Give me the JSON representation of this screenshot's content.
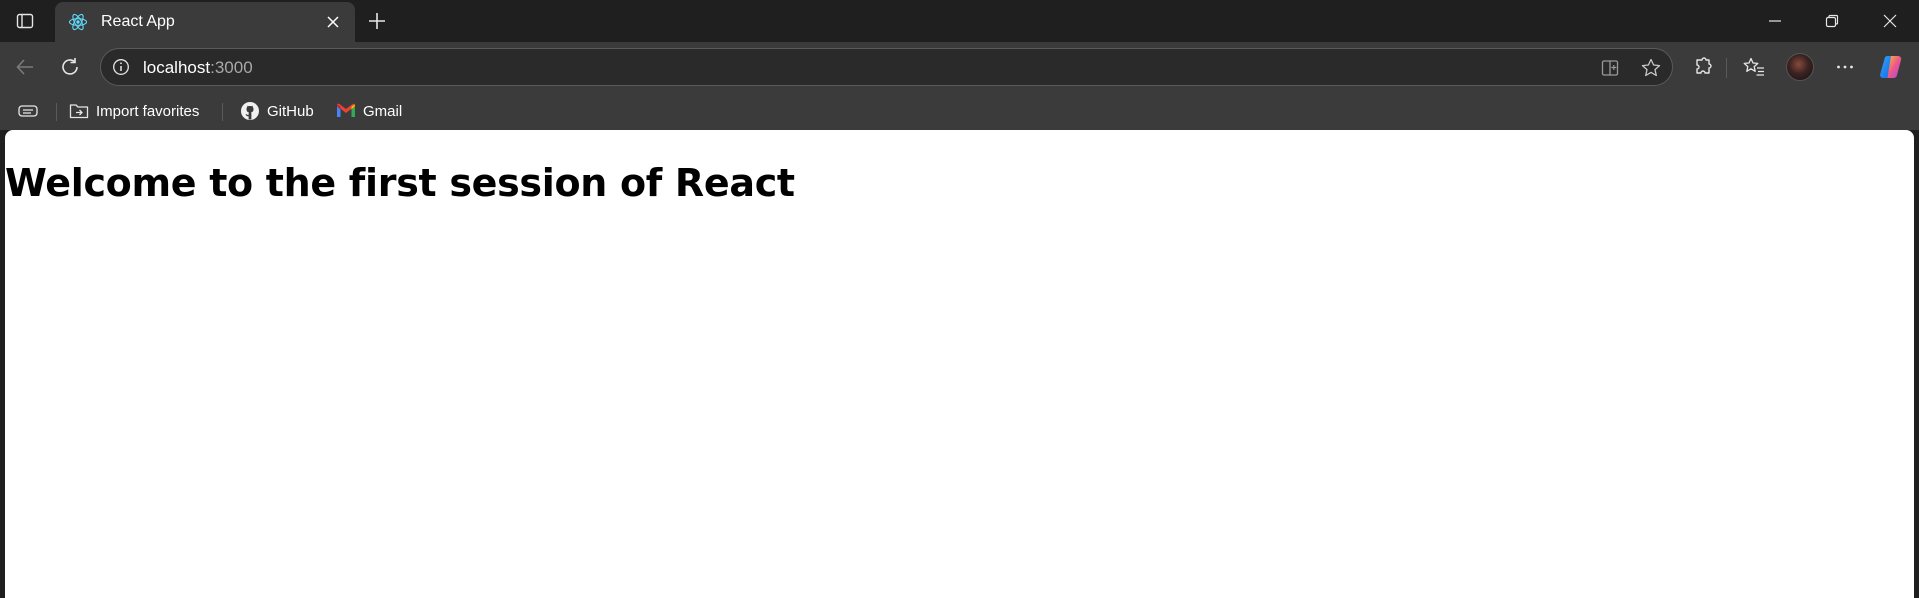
{
  "tab": {
    "title": "React App",
    "favicon": "react-icon"
  },
  "address": {
    "host": "localhost",
    "port": ":3000"
  },
  "bookmarks": [
    {
      "label": "Import favorites",
      "icon": "import-favorites-icon"
    },
    {
      "label": "GitHub",
      "icon": "github-icon"
    },
    {
      "label": "Gmail",
      "icon": "gmail-icon"
    }
  ],
  "page": {
    "heading": "Welcome to the first session of React"
  },
  "colors": {
    "chrome_dark": "#1f1f1f",
    "toolbar": "#3b3b3b",
    "react_blue": "#61dafb"
  }
}
